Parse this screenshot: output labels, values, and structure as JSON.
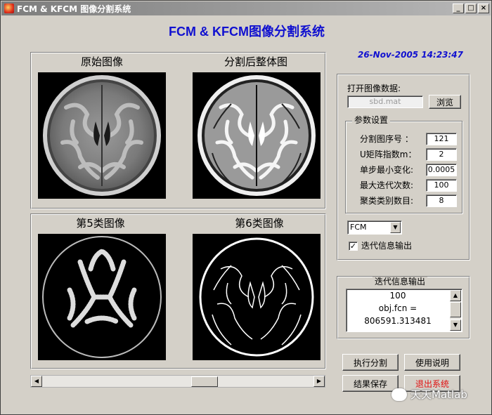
{
  "window": {
    "title": "FCM & KFCM 图像分割系统"
  },
  "app_title": "FCM & KFCM图像分割系统",
  "clock": "26-Nov-2005 14:23:47",
  "images": {
    "original_label": "原始图像",
    "segmented_label": "分割后整体图",
    "class5_label": "第5类图像",
    "class6_label": "第6类图像"
  },
  "open_image": {
    "label": "打开图像数据:",
    "filename": "sbd.mat",
    "browse_label": "浏览"
  },
  "params": {
    "caption": "参数设置",
    "rows": [
      {
        "label": "分割图序号 ：",
        "value": "121"
      },
      {
        "label": "U矩阵指数m：",
        "value": "2"
      },
      {
        "label": "单步最小变化:",
        "value": "0.0005"
      },
      {
        "label": "最大迭代次数:",
        "value": "100"
      },
      {
        "label": "聚类类别数目:",
        "value": "8"
      }
    ]
  },
  "algorithm": {
    "selected": "FCM"
  },
  "iter_checkbox": {
    "label": "迭代信息输出",
    "checked": true,
    "mark": "✓"
  },
  "iter_output": {
    "caption": "迭代信息输出",
    "lines": [
      "100",
      "obj.fcn =",
      "806591.313481"
    ]
  },
  "buttons": {
    "run": "执行分割",
    "help": "使用说明",
    "save": "结果保存",
    "exit": "退出系统"
  },
  "watermark": "天天Matlab",
  "colors": {
    "title_blue": "#1010d0",
    "exit_red": "#e01010"
  }
}
